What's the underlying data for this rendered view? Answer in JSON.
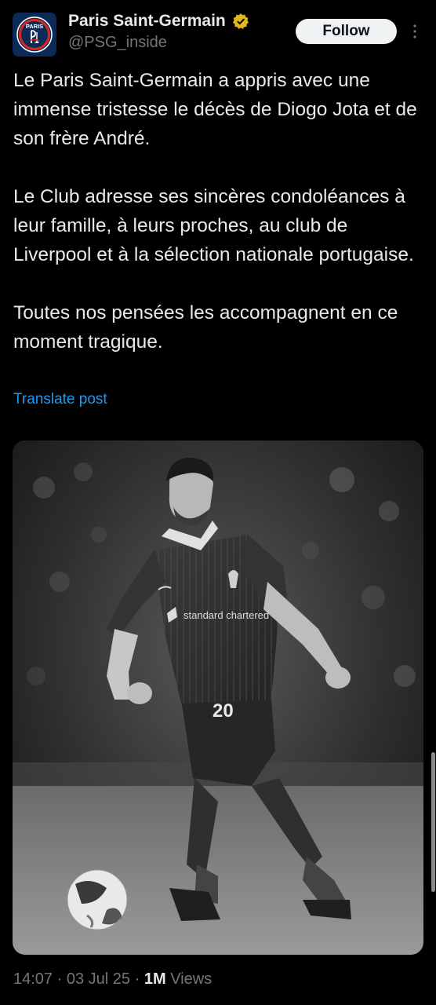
{
  "account": {
    "display_name": "Paris Saint-Germain",
    "handle": "@PSG_inside",
    "avatar_text": "PARIS",
    "verified_color": "#e2b719"
  },
  "actions": {
    "follow_label": "Follow"
  },
  "post": {
    "text": "Le Paris Saint-Germain a appris avec une immense tristesse le décès de Diogo Jota et de son frère André.\n\nLe Club adresse ses sincères condoléances à leur famille, à leurs proches, au club de Liverpool et à la sélection nationale portugaise.\n\nToutes nos pensées les accompagnent en ce moment tragique.",
    "translate_label": "Translate post"
  },
  "media": {
    "shirt_sponsor": "standard chartered",
    "shirt_number": "20"
  },
  "meta": {
    "time": "14:07",
    "separator": "·",
    "date": "03 Jul 25",
    "views_count": "1M",
    "views_label": "Views"
  },
  "colors": {
    "background": "#000000",
    "text_primary": "#e7e9ea",
    "text_secondary": "#71767b",
    "link": "#1d9bf0",
    "psg_blue": "#0b2a58",
    "psg_red": "#da291c"
  }
}
